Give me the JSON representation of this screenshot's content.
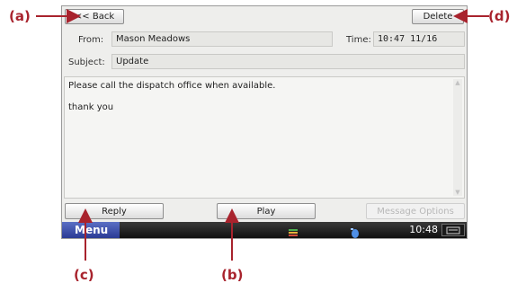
{
  "header": {
    "back_label": "<< Back",
    "delete_label": "Delete"
  },
  "message": {
    "from_label": "From:",
    "from_value": "Mason Meadows",
    "time_label": "Time:",
    "time_value": "10:47  11/16",
    "subject_label": "Subject:",
    "subject_value": "Update",
    "body_lines": [
      "Please call the dispatch office when available.",
      "thank you"
    ]
  },
  "actions": {
    "reply_label": "Reply",
    "play_label": "Play",
    "options_label": "Message Options"
  },
  "taskbar": {
    "menu_label": "Menu",
    "clock": "10:48"
  },
  "callouts": {
    "a": "(a)",
    "b": "(b)",
    "c": "(c)",
    "d": "(d)"
  },
  "colors": {
    "callout": "#a8232d",
    "menu_button": "#3a4ba8"
  }
}
